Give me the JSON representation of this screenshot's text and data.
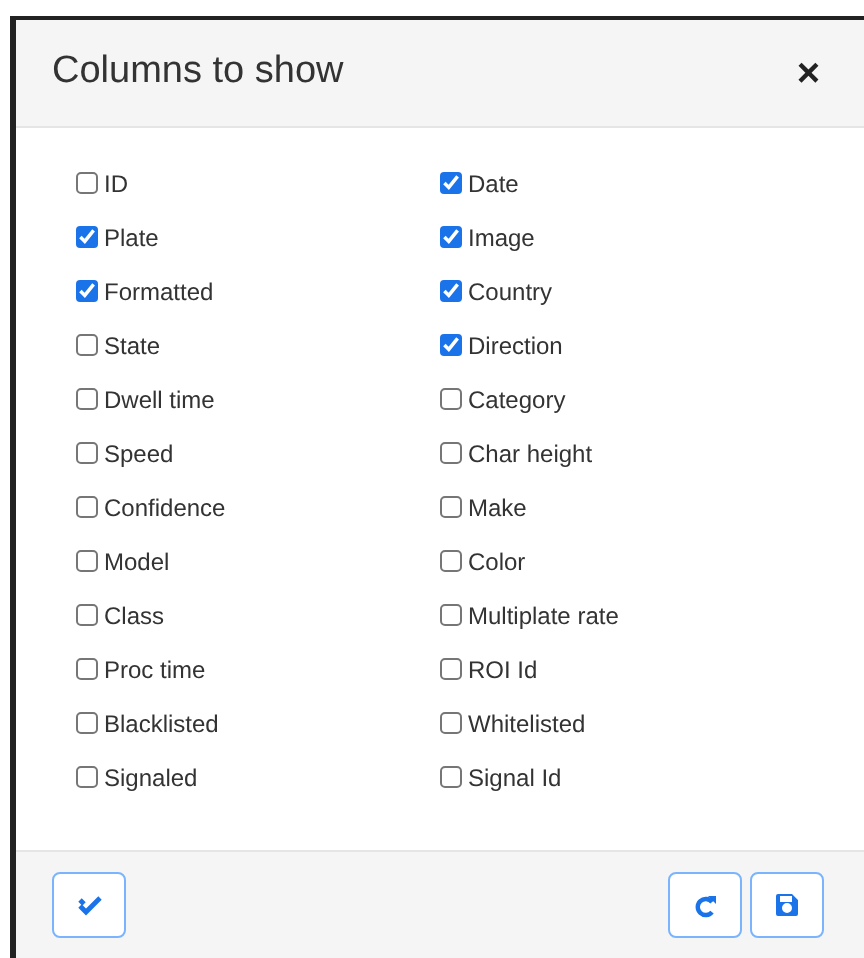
{
  "dialog": {
    "title": "Columns to show",
    "close": "×"
  },
  "columns": [
    [
      {
        "label": "ID",
        "checked": false
      },
      {
        "label": "Plate",
        "checked": true
      },
      {
        "label": "Formatted",
        "checked": true
      },
      {
        "label": "State",
        "checked": false
      },
      {
        "label": "Dwell time",
        "checked": false
      },
      {
        "label": "Speed",
        "checked": false
      },
      {
        "label": "Confidence",
        "checked": false
      },
      {
        "label": "Model",
        "checked": false
      },
      {
        "label": "Class",
        "checked": false
      },
      {
        "label": "Proc time",
        "checked": false
      },
      {
        "label": "Blacklisted",
        "checked": false
      },
      {
        "label": "Signaled",
        "checked": false
      }
    ],
    [
      {
        "label": "Date",
        "checked": true
      },
      {
        "label": "Image",
        "checked": true
      },
      {
        "label": "Country",
        "checked": true
      },
      {
        "label": "Direction",
        "checked": true
      },
      {
        "label": "Category",
        "checked": false
      },
      {
        "label": "Char height",
        "checked": false
      },
      {
        "label": "Make",
        "checked": false
      },
      {
        "label": "Color",
        "checked": false
      },
      {
        "label": "Multiplate rate",
        "checked": false
      },
      {
        "label": "ROI Id",
        "checked": false
      },
      {
        "label": "Whitelisted",
        "checked": false
      },
      {
        "label": "Signal Id",
        "checked": false
      }
    ]
  ]
}
